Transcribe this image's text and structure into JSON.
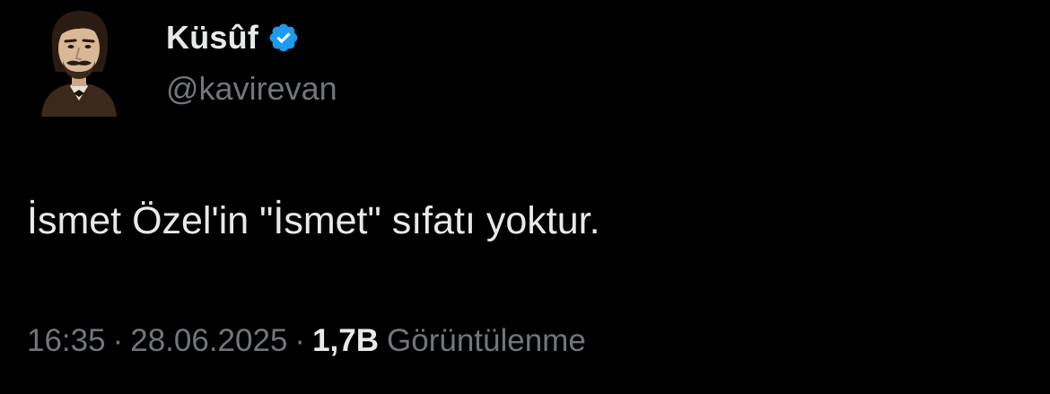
{
  "author": {
    "display_name": "Küsûf",
    "handle": "@kavirevan",
    "verified": true,
    "avatar_icon": "portrait-avatar"
  },
  "tweet": {
    "text": "İsmet Özel'in \"İsmet\" sıfatı yoktur.",
    "time": "16:35",
    "separator": "·",
    "date": "28.06.2025",
    "views_count": "1,7B",
    "views_label": "Görüntülenme"
  },
  "colors": {
    "background": "#000000",
    "primary_text": "#e7e9ea",
    "secondary_text": "#71767b",
    "verified_badge": "#1d9bf0"
  }
}
